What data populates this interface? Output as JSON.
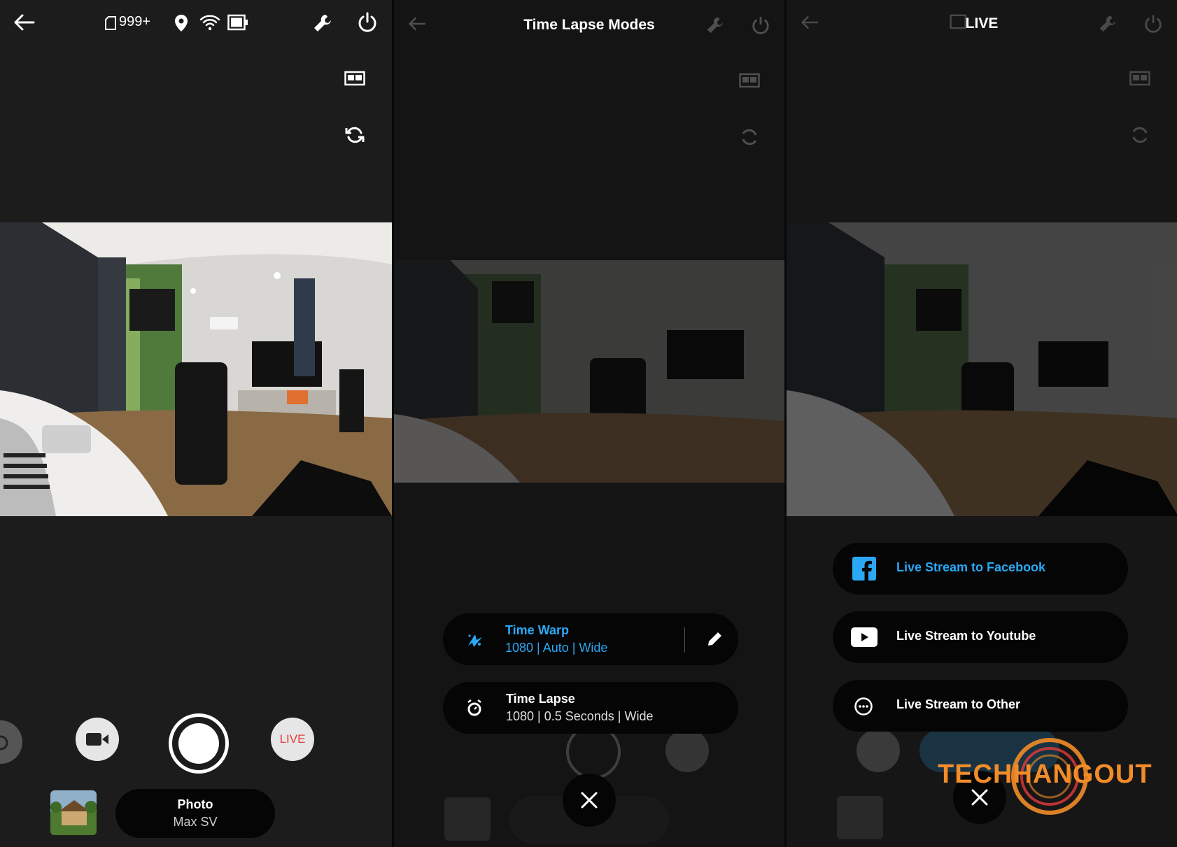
{
  "colors": {
    "accent_blue": "#2aa8f5",
    "live_red": "#e33b3b",
    "orange": "#f28c28"
  },
  "panel_photo": {
    "status": {
      "storage": "999+"
    },
    "icons": [
      "back-arrow-icon",
      "sd-card-icon",
      "location-pin-icon",
      "wifi-icon",
      "battery-icon",
      "wrench-icon",
      "power-icon",
      "display-toggle-icon",
      "flip-camera-icon"
    ],
    "mode_buttons": {
      "live_label": "LIVE"
    },
    "mode_pill": {
      "title": "Photo",
      "subtitle": "Max SV"
    }
  },
  "panel_timelapse": {
    "title": "Time Lapse Modes",
    "options": [
      {
        "title": "Time Warp",
        "subtitle": "1080 | Auto | Wide",
        "selected": true,
        "icon": "time-warp-icon"
      },
      {
        "title": "Time Lapse",
        "subtitle": "1080 | 0.5 Seconds | Wide",
        "selected": false,
        "icon": "timer-icon"
      }
    ],
    "edit_icon": "pencil-icon",
    "close_icon": "close-icon"
  },
  "panel_live": {
    "title": "LIVE",
    "options": [
      {
        "label": "Live Stream to Facebook",
        "selected": true,
        "icon": "facebook-icon"
      },
      {
        "label": "Live Stream to Youtube",
        "selected": false,
        "icon": "youtube-icon"
      },
      {
        "label": "Live Stream to Other",
        "selected": false,
        "icon": "more-circle-icon"
      }
    ],
    "close_icon": "close-icon"
  },
  "watermark": {
    "text_part1": "TECH",
    "text_part2": "HANGOUT"
  }
}
